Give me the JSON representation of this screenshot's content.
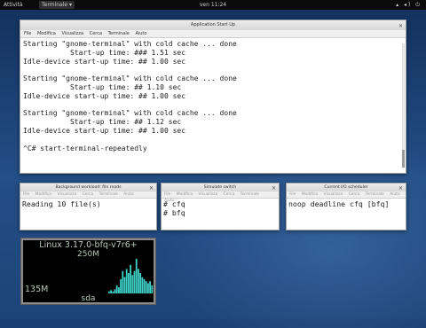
{
  "topbar": {
    "activities": "Attività",
    "app_menu": "Terminale ▾",
    "clock": "ven 11:24",
    "tray": "▴ ◂) ⏻"
  },
  "main_window": {
    "title": "Application Start Up",
    "menu": [
      "File",
      "Modifica",
      "Visualizza",
      "Cerca",
      "Terminale",
      "Aiuto"
    ],
    "lines": [
      "Starting \"gnome-terminal\" with cold cache ... done",
      "           Start-up time: ### 1.51 sec",
      "Idle-device start-up time: ## 1.00 sec",
      "",
      "Starting \"gnome-terminal\" with cold cache ... done",
      "           Start-up time: ## 1.10 sec",
      "Idle-device start-up time: ## 1.00 sec",
      "",
      "Starting \"gnome-terminal\" with cold cache ... done",
      "           Start-up time: ## 1.12 sec",
      "Idle-device start-up time: ## 1.00 sec",
      "",
      "^C# start-terminal-repeatedly"
    ]
  },
  "small_windows": [
    {
      "title": "Background workload: file reads",
      "menu": [
        "File",
        "Modifica",
        "Visualizza",
        "Cerca",
        "Terminale",
        "Aiuto"
      ],
      "lines": [
        "Reading 10 file(s)"
      ]
    },
    {
      "title": "Simulate switch",
      "menu": [
        "File",
        "Modifica",
        "Visualizza",
        "Cerca",
        "Terminale",
        "Aiuto"
      ],
      "lines": [
        "# cfq",
        "# bfq"
      ]
    },
    {
      "title": "Current I/O scheduler",
      "menu": [
        "File",
        "Modifica",
        "Visualizza",
        "Cerca",
        "Terminale",
        "Aiuto"
      ],
      "lines": [
        "noop deadline cfq [bfq]"
      ]
    }
  ],
  "monitor": {
    "header": "Linux 3.17.0-bfq-v7r6+",
    "top_label": "250M",
    "low_label": "135M",
    "device": "sda",
    "colors": {
      "bars": "#3fd0c8",
      "text": "#b8c7b8"
    },
    "levels": [
      0.05,
      0.08,
      0.05,
      0.1,
      0.2,
      0.15,
      0.35,
      0.55,
      0.4,
      0.6,
      0.5,
      0.7,
      0.45,
      0.55,
      0.85,
      0.6,
      0.5,
      0.4,
      0.35,
      0.3,
      0.25,
      0.3,
      0.2
    ]
  }
}
